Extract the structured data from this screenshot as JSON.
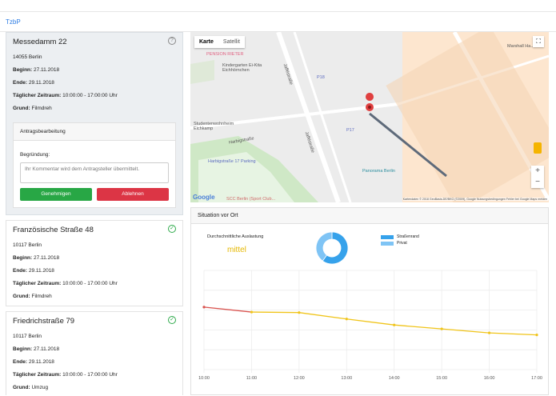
{
  "brand": "TzbP",
  "cards": [
    {
      "title": "Messedamm 22",
      "status": "help",
      "address": "14055 Berlin",
      "begin_label": "Beginn:",
      "begin": "27.11.2018",
      "end_label": "Ende:",
      "end": "29.11.2018",
      "time_label": "Täglicher Zeitraum:",
      "time": "10:00:00 - 17:00:00 Uhr",
      "reason_label": "Grund:",
      "reason": "Filmdreh"
    },
    {
      "title": "Französische Straße 48",
      "status": "ok",
      "address": "10117 Berlin",
      "begin_label": "Beginn:",
      "begin": "27.11.2018",
      "end_label": "Ende:",
      "end": "29.11.2018",
      "time_label": "Täglicher Zeitraum:",
      "time": "10:00:00 - 17:00:00 Uhr",
      "reason_label": "Grund:",
      "reason": "Filmdreh"
    },
    {
      "title": "Friedrichstraße 79",
      "status": "ok",
      "address": "10117 Berlin",
      "begin_label": "Beginn:",
      "begin": "27.11.2018",
      "end_label": "Ende:",
      "end": "29.11.2018",
      "time_label": "Täglicher Zeitraum:",
      "time": "10:00:00 - 17:00:00 Uhr",
      "reason_label": "Grund:",
      "reason": "Umzug"
    }
  ],
  "processing": {
    "title": "Antragsbearbeitung",
    "reason_label": "Begründung:",
    "placeholder": "Ihr Kommentar wird dem Antragsteller übermittelt.",
    "approve": "Genehmigen",
    "reject": "Ablehnen"
  },
  "map": {
    "tab_map": "Karte",
    "tab_satellite": "Satellit",
    "labels": {
      "pension": "PENSION RIETER",
      "kita": "Kindergarten Ei-Kita Eichhörnchen",
      "p18": "P18",
      "p17": "P17",
      "jafferstr1": "Jafféstraße",
      "jafferstr2": "Jafféstraße",
      "wohnheim": "Studentenwohnheim Eichkamp",
      "harbig": "Harbigstraße",
      "parking": "Harbigstraße 17 Parking",
      "panorama": "Panorama Berlin",
      "marshall": "Marshall Ha...",
      "scc": "SCC Berlin (Sport Club..."
    },
    "google": "Google",
    "attribution": "Kartendaten © 2018 GeoBasis-DE/BKG (©2009), Google   Nutzungsbedingungen   Fehler bei Google Maps melden",
    "zoom_in": "+",
    "zoom_out": "−"
  },
  "situation": {
    "title": "Situation vor Ort",
    "avg_label": "Durchschnittliche Auslastung",
    "avg_value": "mittel",
    "legend": [
      {
        "name": "Straßenrand",
        "color": "#36a2eb"
      },
      {
        "name": "Privat",
        "color": "#7fc4f5"
      }
    ]
  },
  "chart_data": [
    {
      "type": "pie",
      "labels": [
        "Straßenrand",
        "Privat"
      ],
      "values": [
        60,
        40
      ],
      "colors": [
        "#36a2eb",
        "#7fc4f5"
      ]
    },
    {
      "type": "line",
      "categories": [
        "10:00",
        "11:00",
        "12:00",
        "13:00",
        "14:00",
        "15:00",
        "16:00",
        "17:00"
      ],
      "values": [
        63,
        58,
        57.5,
        51,
        45,
        41,
        37,
        35
      ],
      "ylim": [
        0,
        100
      ],
      "grid": true,
      "colors": [
        "#d9534f",
        "#f0c419"
      ]
    }
  ]
}
